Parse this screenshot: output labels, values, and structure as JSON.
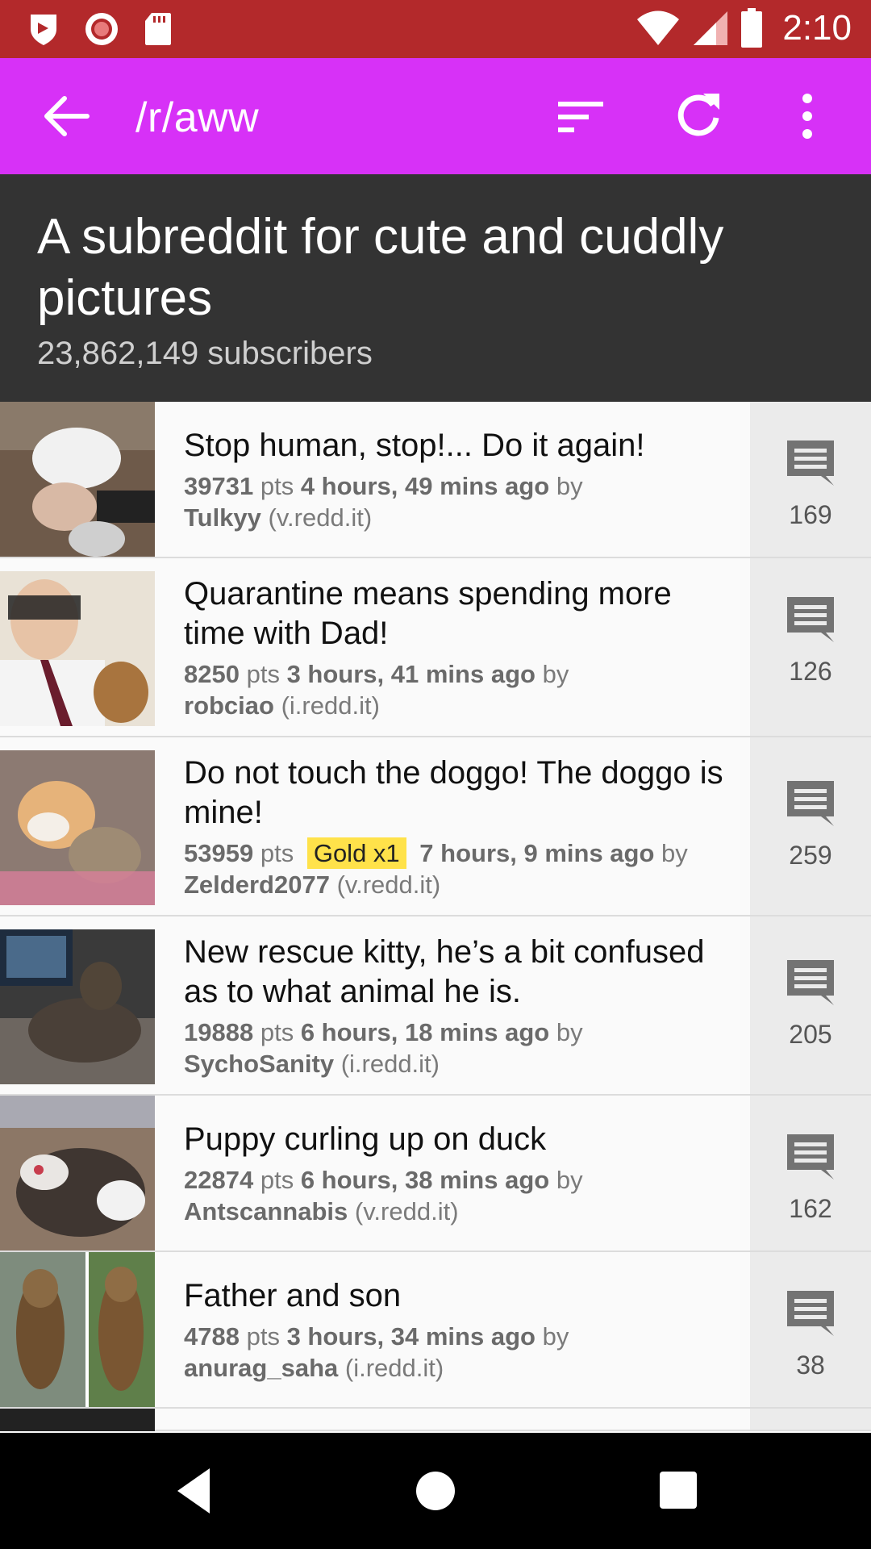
{
  "status_bar": {
    "time": "2:10",
    "icons": [
      "shield-icon",
      "record-icon",
      "sd-card-icon",
      "wifi-icon",
      "signal-icon",
      "battery-icon"
    ]
  },
  "app_bar": {
    "title": "/r/aww",
    "color": "#d731f7",
    "icons": [
      "back-arrow-icon",
      "sort-icon",
      "refresh-icon",
      "more-vert-icon"
    ]
  },
  "header": {
    "title": "A subreddit for cute and cuddly pictures",
    "subscribers": "23,862,149 subscribers"
  },
  "posts": [
    {
      "title": "Stop human, stop!... Do it again!",
      "points": "39731",
      "pts_label": "pts",
      "time": "4 hours, 49 mins ago",
      "by_label": "by",
      "author": "Tulkyy",
      "domain": "(v.redd.it)",
      "comments": "169",
      "gold": ""
    },
    {
      "title": "Quarantine means spending more time with Dad!",
      "points": "8250",
      "pts_label": "pts",
      "time": "3 hours, 41 mins ago",
      "by_label": "by",
      "author": "robciao",
      "domain": "(i.redd.it)",
      "comments": "126",
      "gold": ""
    },
    {
      "title": "Do not touch the doggo! The doggo is mine!",
      "points": "53959",
      "pts_label": "pts",
      "time": "7 hours, 9 mins ago",
      "by_label": "by",
      "author": "Zelderd2077",
      "domain": "(v.redd.it)",
      "comments": "259",
      "gold": "Gold x1"
    },
    {
      "title": "New rescue kitty, he’s a bit confused as to what animal he is.",
      "points": "19888",
      "pts_label": "pts",
      "time": "6 hours, 18 mins ago",
      "by_label": "by",
      "author": "SychoSanity",
      "domain": "(i.redd.it)",
      "comments": "205",
      "gold": ""
    },
    {
      "title": "Puppy curling up on duck",
      "points": "22874",
      "pts_label": "pts",
      "time": "6 hours, 38 mins ago",
      "by_label": "by",
      "author": "Antscannabis",
      "domain": "(v.redd.it)",
      "comments": "162",
      "gold": ""
    },
    {
      "title": "Father and son",
      "points": "4788",
      "pts_label": "pts",
      "time": "3 hours, 34 mins ago",
      "by_label": "by",
      "author": "anurag_saha",
      "domain": "(i.redd.it)",
      "comments": "38",
      "gold": ""
    }
  ],
  "nav_bar": {
    "icons": [
      "back-triangle-icon",
      "home-circle-icon",
      "recents-square-icon"
    ]
  }
}
